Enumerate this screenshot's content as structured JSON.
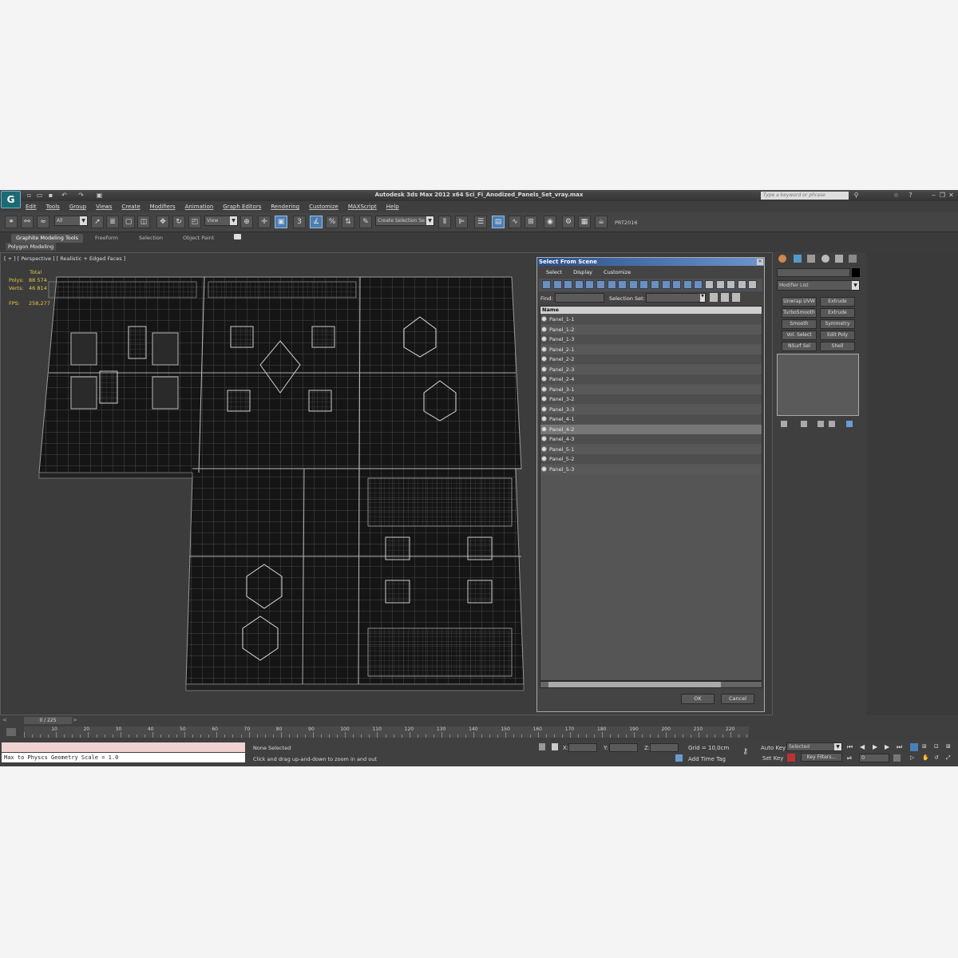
{
  "app": {
    "title": "Autodesk 3ds Max  2012 x64    Sci_Fi_Anodized_Panels_Set_vray.max",
    "search_placeholder": "Type a keyword or phrase",
    "menus": [
      "Edit",
      "Tools",
      "Group",
      "Views",
      "Create",
      "Modifiers",
      "Animation",
      "Graph Editors",
      "Rendering",
      "Customize",
      "MAXScript",
      "Help"
    ]
  },
  "toolbar": {
    "filter": "All",
    "reference": "View",
    "selection_set": "Create Selection Se",
    "plugin": "PRT2016"
  },
  "ribbon": {
    "tabs": [
      "Graphite Modeling Tools",
      "Freeform",
      "Selection",
      "Object Paint"
    ],
    "sub": "Polygon Modeling"
  },
  "viewport": {
    "label": "[ + ] [ Perspective ] [ Realistic + Edged Faces ]",
    "total_label": "Total",
    "polys_label": "Polys:",
    "polys": "88 574",
    "verts_label": "Verts:",
    "verts": "46 814",
    "fps_label": "FPS:",
    "fps": "258,277"
  },
  "dialog": {
    "title": "Select From Scene",
    "menus": [
      "Select",
      "Display",
      "Customize"
    ],
    "find_label": "Find:",
    "selset_label": "Selection Set:",
    "column": "Name",
    "items": [
      "Panel_1-1",
      "Panel_1-2",
      "Panel_1-3",
      "Panel_2-1",
      "Panel_2-2",
      "Panel_2-3",
      "Panel_2-4",
      "Panel_3-1",
      "Panel_3-2",
      "Panel_3-3",
      "Panel_4-1",
      "Panel_4-2",
      "Panel_4-3",
      "Panel_5-1",
      "Panel_5-2",
      "Panel_5-3"
    ],
    "selected_index": 11,
    "ok": "OK",
    "cancel": "Cancel"
  },
  "command_panel": {
    "modifier_list": "Modifier List",
    "buttons": [
      "Unwrap UVW",
      "Extrude",
      "TurboSmooth",
      "Extrude",
      "Smooth",
      "Symmetry",
      "Vol. Select",
      "Edit Poly",
      "NSurf Sel",
      "Shell"
    ]
  },
  "timeline": {
    "frame": "0 / 225",
    "ticks": [
      "10",
      "20",
      "30",
      "40",
      "50",
      "60",
      "70",
      "80",
      "90",
      "100",
      "110",
      "120",
      "130",
      "140",
      "150",
      "160",
      "170",
      "180",
      "190",
      "200",
      "210",
      "220"
    ]
  },
  "status": {
    "script_output": "Max to Physcs Geometry Scale = 1.0",
    "selection": "None Selected",
    "prompt": "Click and drag up-and-down to zoom in and out",
    "x_label": "X:",
    "y_label": "Y:",
    "z_label": "Z:",
    "grid": "Grid = 10,0cm",
    "add_time_tag": "Add Time Tag",
    "auto_key": "Auto Key",
    "set_key": "Set Key",
    "key_mode": "Selected",
    "key_filters": "Key Filters...",
    "frame_field": "0"
  },
  "colors": {
    "accent": "#4a7fb4",
    "stats": "#e8c640",
    "dialog_title": "#2a4f8a"
  }
}
